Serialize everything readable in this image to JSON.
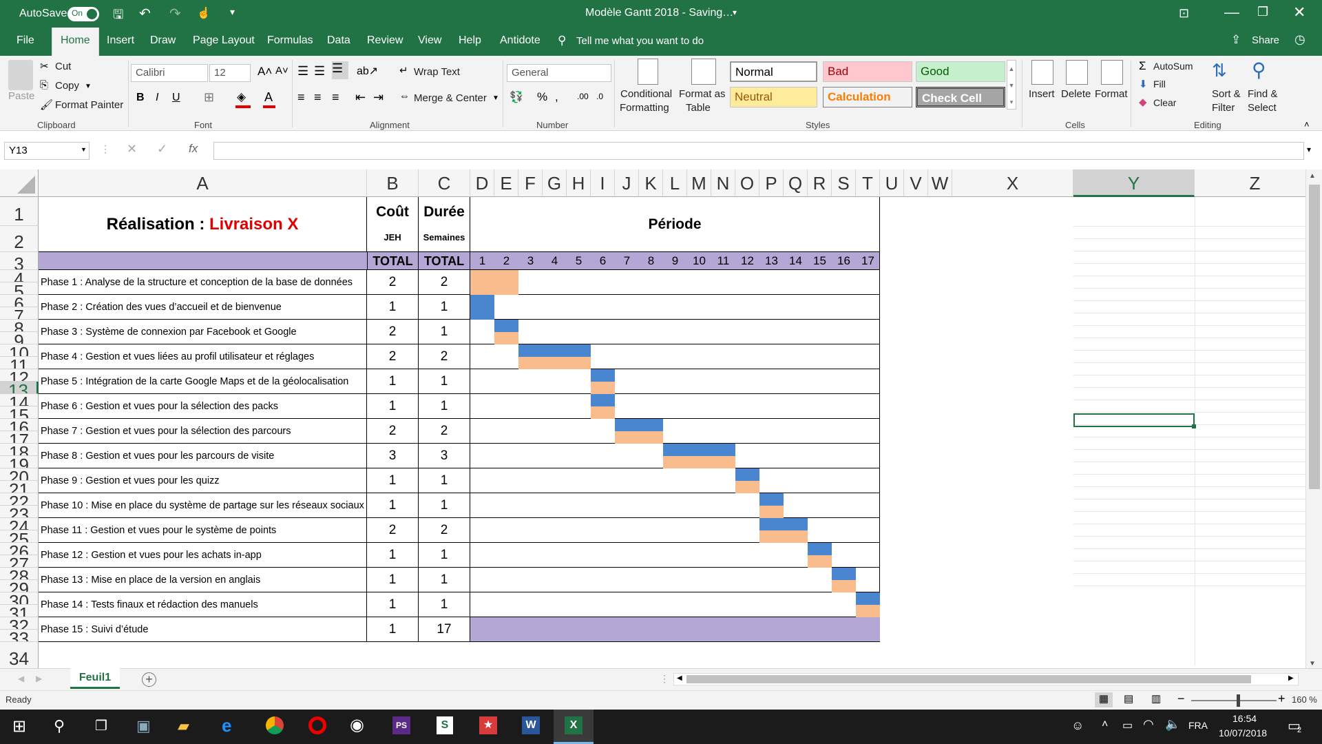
{
  "titlebar": {
    "autosave_label": "AutoSave",
    "autosave_state": "On",
    "document_title": "Modèle Gantt 2018 - Saving...",
    "title_display": "Modèle Gantt 2018  -  Saving…"
  },
  "ribbon_tabs": [
    "File",
    "Home",
    "Insert",
    "Draw",
    "Page Layout",
    "Formulas",
    "Data",
    "Review",
    "View",
    "Help",
    "Antidote"
  ],
  "tell_me": "Tell me what you want to do",
  "share_label": "Share",
  "ribbon": {
    "clipboard": {
      "paste": "Paste",
      "cut": "Cut",
      "copy": "Copy",
      "format_painter": "Format Painter",
      "label": "Clipboard"
    },
    "font": {
      "name": "Calibri",
      "size": "12",
      "label": "Font"
    },
    "alignment": {
      "wrap": "Wrap Text",
      "merge": "Merge & Center",
      "label": "Alignment"
    },
    "number": {
      "format": "General",
      "label": "Number"
    },
    "styles": {
      "conditional": "Conditional Formatting",
      "conditional_l1": "Conditional",
      "conditional_l2": "Formatting",
      "format_table_l1": "Format as",
      "format_table_l2": "Table",
      "normal": "Normal",
      "bad": "Bad",
      "good": "Good",
      "neutral": "Neutral",
      "calculation": "Calculation",
      "check_cell": "Check Cell",
      "label": "Styles"
    },
    "cells": {
      "insert": "Insert",
      "delete": "Delete",
      "format": "Format",
      "label": "Cells"
    },
    "editing": {
      "autosum": "AutoSum",
      "fill": "Fill",
      "clear": "Clear",
      "sort_l1": "Sort &",
      "sort_l2": "Filter",
      "find_l1": "Find &",
      "find_l2": "Select",
      "label": "Editing"
    }
  },
  "formula_bar": {
    "name_box": "Y13",
    "content": ""
  },
  "columns": [
    "A",
    "B",
    "C",
    "D",
    "E",
    "F",
    "G",
    "H",
    "I",
    "J",
    "K",
    "L",
    "M",
    "N",
    "O",
    "P",
    "Q",
    "R",
    "S",
    "T",
    "U",
    "V",
    "W",
    "X",
    "Y",
    "Z"
  ],
  "rows": [
    "1",
    "2",
    "3",
    "4",
    "5",
    "6",
    "7",
    "8",
    "9",
    "10",
    "11",
    "12",
    "13",
    "14",
    "15",
    "16",
    "17",
    "18",
    "19",
    "20",
    "21",
    "22",
    "23",
    "24",
    "25",
    "26",
    "27",
    "28",
    "29",
    "30",
    "31",
    "32",
    "33",
    "34"
  ],
  "header": {
    "title_prefix": "Réalisation : ",
    "title_highlight": "Livraison X",
    "cost": "Coût",
    "cost_unit": "JEH",
    "duration": "Durée",
    "duration_unit": "Semaines",
    "period": "Période",
    "total_b": "TOTAL",
    "total_c": "TOTAL"
  },
  "period_weeks": [
    "1",
    "2",
    "3",
    "4",
    "5",
    "6",
    "7",
    "8",
    "9",
    "10",
    "11",
    "12",
    "13",
    "14",
    "15",
    "16",
    "17"
  ],
  "phases": [
    {
      "name": "Phase 1 : Analyse de la structure et conception de la base de données",
      "cost": "2",
      "duration": "2"
    },
    {
      "name": "Phase 2 : Création des vues d’accueil et de bienvenue",
      "cost": "1",
      "duration": "1"
    },
    {
      "name": "Phase 3 : Système de connexion par Facebook et Google",
      "cost": "2",
      "duration": "1"
    },
    {
      "name": "Phase 4 : Gestion et vues liées au profil utilisateur et réglages",
      "cost": "2",
      "duration": "2"
    },
    {
      "name": "Phase 5 : Intégration de la carte Google Maps et de la géolocalisation",
      "cost": "1",
      "duration": "1"
    },
    {
      "name": "Phase 6 : Gestion et vues pour la sélection des packs",
      "cost": "1",
      "duration": "1"
    },
    {
      "name": "Phase 7 : Gestion et vues pour la sélection des parcours",
      "cost": "2",
      "duration": "2"
    },
    {
      "name": "Phase 8 : Gestion et vues pour les parcours de visite",
      "cost": "3",
      "duration": "3"
    },
    {
      "name": "Phase 9 : Gestion et vues pour les quizz",
      "cost": "1",
      "duration": "1"
    },
    {
      "name": "Phase 10 : Mise en place du système de partage sur les réseaux sociaux",
      "cost": "1",
      "duration": "1"
    },
    {
      "name": "Phase 11 : Gestion et vues pour le système de points",
      "cost": "2",
      "duration": "2"
    },
    {
      "name": "Phase 12 : Gestion et vues pour les achats in-app",
      "cost": "1",
      "duration": "1"
    },
    {
      "name": "Phase 13 : Mise en place de la version en anglais",
      "cost": "1",
      "duration": "1"
    },
    {
      "name": "Phase 14 : Tests finaux et rédaction des manuels",
      "cost": "1",
      "duration": "1"
    },
    {
      "name": "Phase 15 : Suivi d’étude",
      "cost": "1",
      "duration": "17"
    }
  ],
  "gantt_bars": [
    {
      "phase": 1,
      "start": 1,
      "weeks": 2,
      "blue": false,
      "orange": true,
      "full": true
    },
    {
      "phase": 2,
      "start": 1,
      "weeks": 1,
      "blue": true,
      "orange": false,
      "full": true
    },
    {
      "phase": 3,
      "start": 2,
      "weeks": 1,
      "blue": true,
      "orange": true
    },
    {
      "phase": 4,
      "start": 3,
      "weeks": 3,
      "blue": true,
      "orange": true
    },
    {
      "phase": 5,
      "start": 6,
      "weeks": 1,
      "blue": true,
      "orange": true
    },
    {
      "phase": 6,
      "start": 6,
      "weeks": 1,
      "blue": true,
      "orange": true
    },
    {
      "phase": 7,
      "start": 7,
      "weeks": 2,
      "blue": true,
      "orange": true
    },
    {
      "phase": 8,
      "start": 9,
      "weeks": 3,
      "blue": true,
      "orange": true
    },
    {
      "phase": 9,
      "start": 12,
      "weeks": 1,
      "blue": true,
      "orange": true
    },
    {
      "phase": 10,
      "start": 13,
      "weeks": 1,
      "blue": true,
      "orange": true
    },
    {
      "phase": 11,
      "start": 13,
      "weeks": 2,
      "blue": true,
      "orange": true
    },
    {
      "phase": 12,
      "start": 15,
      "weeks": 1,
      "blue": true,
      "orange": true
    },
    {
      "phase": 13,
      "start": 16,
      "weeks": 1,
      "blue": true,
      "orange": true
    },
    {
      "phase": 14,
      "start": 17,
      "weeks": 1,
      "blue": true,
      "orange": true
    },
    {
      "phase": 15,
      "start": 1,
      "weeks": 17,
      "purple": true
    }
  ],
  "sheet_tab": "Feuil1",
  "status": {
    "ready": "Ready",
    "zoom": "160 %"
  },
  "taskbar": {
    "lang": "FRA",
    "time": "16:54",
    "date": "10/07/2018",
    "notif_count": "2"
  },
  "colors": {
    "excel_green": "#217346",
    "header_purple": "#b4a7d6",
    "bar_blue": "#4a86d0",
    "bar_orange": "#f9bd8d",
    "title_red": "#e00000"
  }
}
